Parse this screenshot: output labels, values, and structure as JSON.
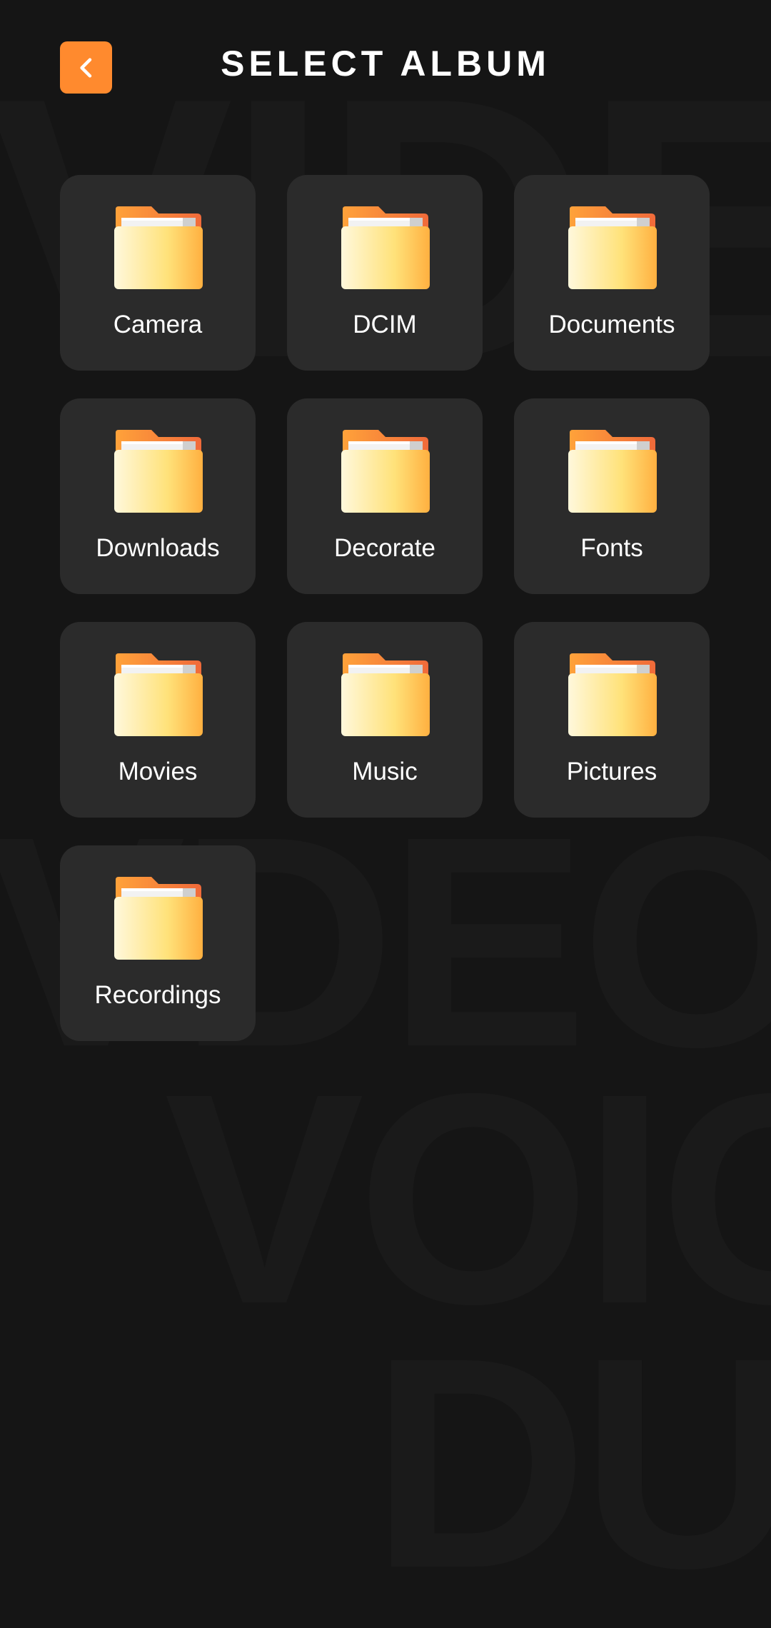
{
  "header": {
    "title": "SELECT ALBUM",
    "back_icon": "chevron-left-icon"
  },
  "watermark": {
    "text": [
      "VIDEO",
      "VDEO",
      "VOIO",
      "DUI"
    ]
  },
  "albums": [
    {
      "label": "Camera",
      "icon": "folder-icon"
    },
    {
      "label": "DCIM",
      "icon": "folder-icon"
    },
    {
      "label": "Documents",
      "icon": "folder-icon"
    },
    {
      "label": "Downloads",
      "icon": "folder-icon"
    },
    {
      "label": "Decorate",
      "icon": "folder-icon"
    },
    {
      "label": "Fonts",
      "icon": "folder-icon"
    },
    {
      "label": "Movies",
      "icon": "folder-icon"
    },
    {
      "label": "Music",
      "icon": "folder-icon"
    },
    {
      "label": "Pictures",
      "icon": "folder-icon"
    },
    {
      "label": "Recordings",
      "icon": "folder-icon"
    }
  ],
  "colors": {
    "background": "#151515",
    "card": "#2b2b2b",
    "accent": "#ff8a2e",
    "text": "#ffffff"
  }
}
